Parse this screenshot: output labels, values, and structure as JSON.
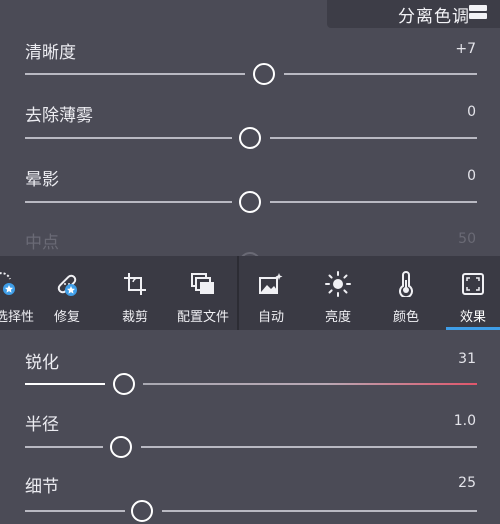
{
  "header": {
    "split_toning_label": "分离色调",
    "split_toning_icon": "split-toning-icon"
  },
  "top_sliders": [
    {
      "label": "清晰度",
      "value": "+7",
      "level": 0.535
    },
    {
      "label": "去除薄雾",
      "value": "0",
      "level": 0.5
    },
    {
      "label": "晕影",
      "value": "0",
      "level": 0.5
    },
    {
      "label": "中点",
      "value": "50",
      "level": 0.5,
      "disabled": true
    }
  ],
  "toolbar": {
    "left_tools": [
      {
        "label": "选择性",
        "icon": "selective-icon"
      },
      {
        "label": "修复",
        "icon": "bandage-icon"
      },
      {
        "label": "裁剪",
        "icon": "crop-icon"
      },
      {
        "label": "配置文件",
        "icon": "profiles-icon"
      }
    ],
    "right_tools": [
      {
        "label": "自动",
        "icon": "auto-photo-icon"
      },
      {
        "label": "亮度",
        "icon": "sun-icon"
      },
      {
        "label": "颜色",
        "icon": "thermometer-icon"
      },
      {
        "label": "效果",
        "icon": "effects-icon",
        "active": true
      }
    ],
    "accent_color": "#3f9ee8"
  },
  "bottom_sliders": [
    {
      "label": "锐化",
      "value": "31",
      "level": 0.31,
      "accent": "#e0566b"
    },
    {
      "label": "半径",
      "value": "1.0",
      "level": 0.22
    },
    {
      "label": "细节",
      "value": "25",
      "level": 0.25
    }
  ]
}
